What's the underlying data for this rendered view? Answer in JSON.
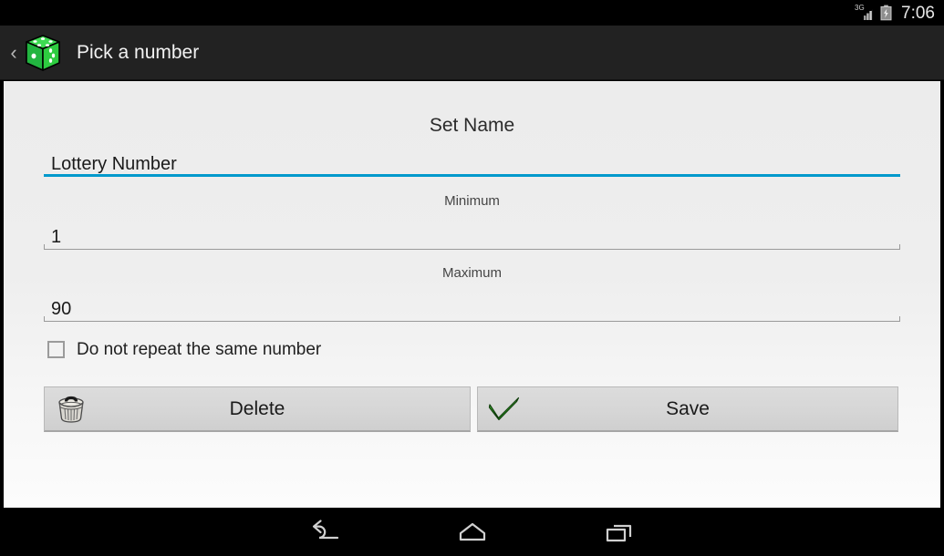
{
  "status_bar": {
    "network_label": "3G",
    "signal_icon": "signal-3g-icon",
    "battery_icon": "battery-charging-icon",
    "time": "7:06"
  },
  "action_bar": {
    "back_icon": "back-chevron-icon",
    "back_glyph": "‹",
    "app_icon": "dice-icon",
    "title": "Pick a number"
  },
  "form": {
    "set_name": {
      "label": "Set Name",
      "value": "Lottery Number",
      "placeholder": "Set Name",
      "focused": true,
      "accent_color": "#0099cc"
    },
    "minimum": {
      "label": "Minimum",
      "value": "1",
      "placeholder": "Minimum",
      "focused": false
    },
    "maximum": {
      "label": "Maximum",
      "value": "90",
      "placeholder": "Maximum",
      "focused": false
    },
    "no_repeat": {
      "label": "Do not repeat the same number",
      "checked": false
    }
  },
  "buttons": {
    "delete": {
      "label": "Delete",
      "icon": "trash-can-icon"
    },
    "save": {
      "label": "Save",
      "icon": "green-checkmark-icon"
    }
  },
  "nav_bar": {
    "back": "back-icon",
    "home": "home-icon",
    "recents": "recent-apps-icon"
  },
  "colors": {
    "accent": "#0099cc",
    "action_bar": "#222222",
    "status_bar": "#000000",
    "dice_green": "#2ecc40",
    "check_green": "#3fbb32"
  }
}
